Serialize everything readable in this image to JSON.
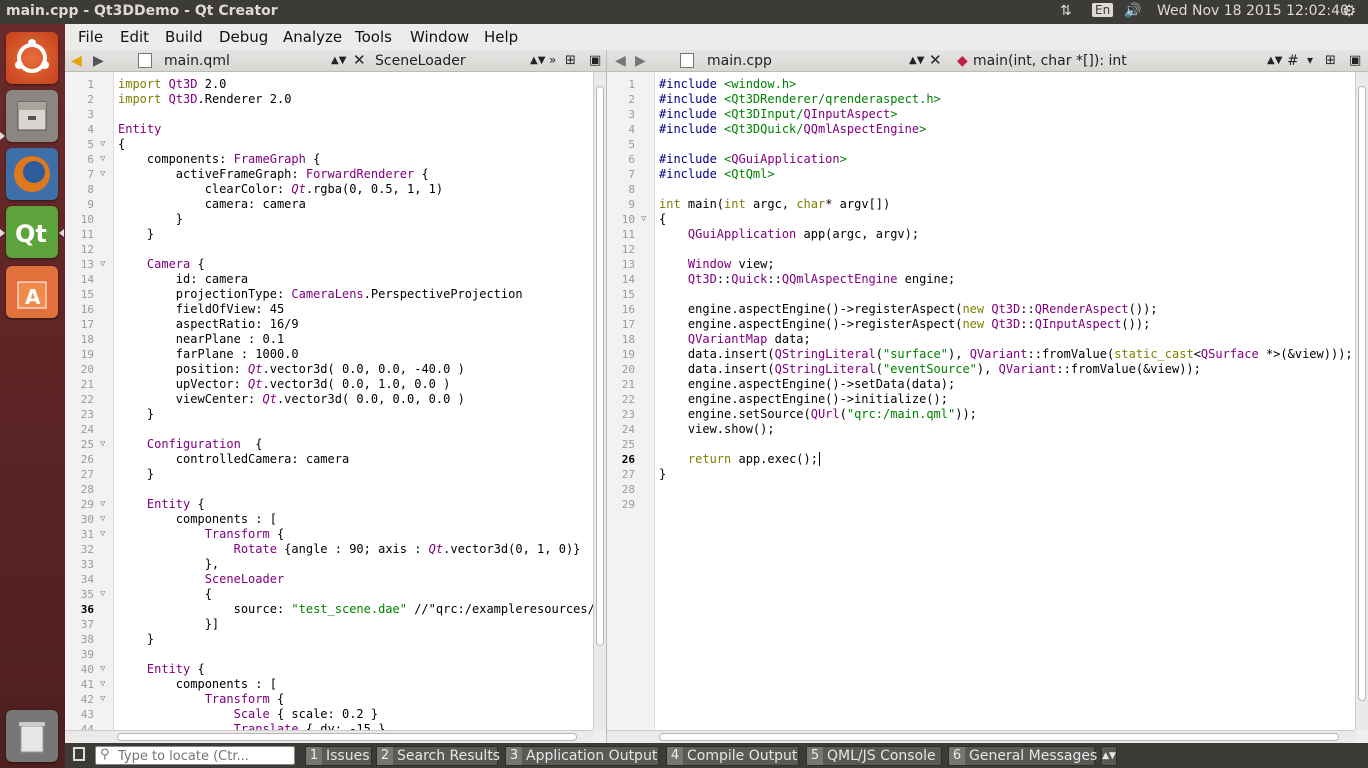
{
  "window_title": "main.cpp - Qt3DDemo - Qt Creator",
  "indicators": {
    "keyboard": "En",
    "clock": "Wed Nov 18 2015 12:02:40"
  },
  "menu": [
    "File",
    "Edit",
    "Build",
    "Debug",
    "Analyze",
    "Tools",
    "Window",
    "Help"
  ],
  "left_pane": {
    "file": "main.qml",
    "symbol": "SceneLoader",
    "current_line": "36",
    "lines": [
      "import Qt3D 2.0",
      "import Qt3D.Renderer 2.0",
      "",
      "Entity",
      "{",
      "    components: FrameGraph {",
      "        activeFrameGraph: ForwardRenderer {",
      "            clearColor: Qt.rgba(0, 0.5, 1, 1)",
      "            camera: camera",
      "        }",
      "    }",
      "",
      "    Camera {",
      "        id: camera",
      "        projectionType: CameraLens.PerspectiveProjection",
      "        fieldOfView: 45",
      "        aspectRatio: 16/9",
      "        nearPlane : 0.1",
      "        farPlane : 1000.0",
      "        position: Qt.vector3d( 0.0, 0.0, -40.0 )",
      "        upVector: Qt.vector3d( 0.0, 1.0, 0.0 )",
      "        viewCenter: Qt.vector3d( 0.0, 0.0, 0.0 )",
      "    }",
      "",
      "    Configuration  {",
      "        controlledCamera: camera",
      "    }",
      "",
      "    Entity {",
      "        components : [",
      "            Transform {",
      "                Rotate {angle : 90; axis : Qt.vector3d(0, 1, 0)}",
      "            },",
      "            SceneLoader",
      "            {",
      "                source: \"test_scene.dae\" //\"qrc:/exampleresources/",
      "            }]",
      "    }",
      "",
      "    Entity {",
      "        components : [",
      "            Transform {",
      "                Scale { scale: 0.2 }",
      "                Translate { dy: -15 }"
    ]
  },
  "right_pane": {
    "file": "main.cpp",
    "symbol": "main(int, char *[]): int",
    "current_line": "26",
    "lines": [
      "#include <window.h>",
      "#include <Qt3DRenderer/qrenderaspect.h>",
      "#include <Qt3DInput/QInputAspect>",
      "#include <Qt3DQuick/QQmlAspectEngine>",
      "",
      "#include <QGuiApplication>",
      "#include <QtQml>",
      "",
      "int main(int argc, char* argv[])",
      "{",
      "    QGuiApplication app(argc, argv);",
      "",
      "    Window view;",
      "    Qt3D::Quick::QQmlAspectEngine engine;",
      "",
      "    engine.aspectEngine()->registerAspect(new Qt3D::QRenderAspect());",
      "    engine.aspectEngine()->registerAspect(new Qt3D::QInputAspect());",
      "    QVariantMap data;",
      "    data.insert(QStringLiteral(\"surface\"), QVariant::fromValue(static_cast<QSurface *>(&view)));",
      "    data.insert(QStringLiteral(\"eventSource\"), QVariant::fromValue(&view));",
      "    engine.aspectEngine()->setData(data);",
      "    engine.aspectEngine()->initialize();",
      "    engine.setSource(QUrl(\"qrc:/main.qml\"));",
      "    view.show();",
      "",
      "    return app.exec();",
      "}",
      "",
      ""
    ]
  },
  "locator_placeholder": "Type to locate (Ctr...",
  "output_tabs": [
    {
      "num": "1",
      "label": "Issues"
    },
    {
      "num": "2",
      "label": "Search Results"
    },
    {
      "num": "3",
      "label": "Application Output"
    },
    {
      "num": "4",
      "label": "Compile Output"
    },
    {
      "num": "5",
      "label": "QML/JS Console"
    },
    {
      "num": "6",
      "label": "General Messages"
    }
  ],
  "colors": {
    "keyword": "#808000",
    "type": "#800080",
    "string": "#008000",
    "include": "#000080",
    "error_underline": "#ff0000",
    "launcher": "#5c2424"
  }
}
